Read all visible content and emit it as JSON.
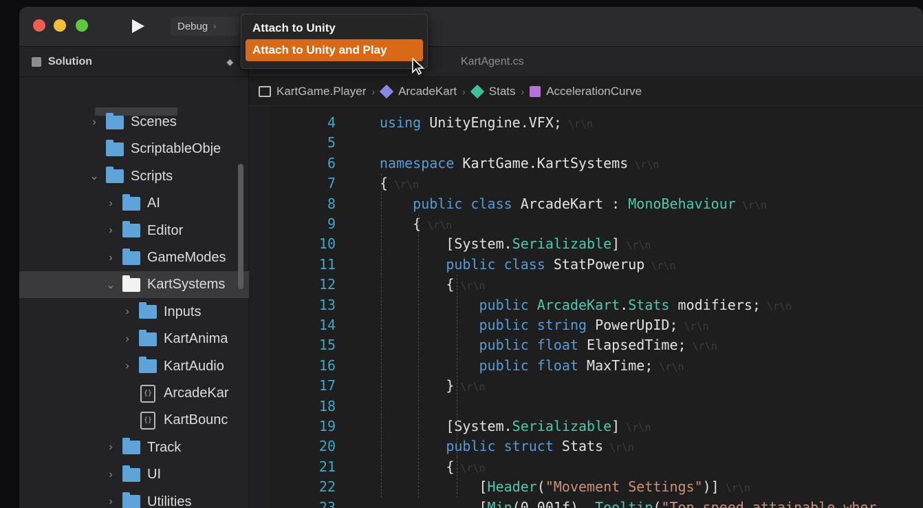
{
  "toolbar": {
    "configuration": "Debug",
    "run_menu": [
      {
        "label": "Attach to Unity",
        "active": false
      },
      {
        "label": "Attach to Unity and Play",
        "active": true
      }
    ]
  },
  "solution_pad": {
    "title": "Solution",
    "items": [
      {
        "label": "Scenes",
        "icon": "folder-icon",
        "expanded": false
      },
      {
        "label": "ScriptableObje",
        "icon": "folder-icon",
        "expanded": null
      },
      {
        "label": "Scripts",
        "icon": "folder-icon",
        "expanded": true
      },
      {
        "label": "AI",
        "icon": "folder-icon",
        "expanded": false
      },
      {
        "label": "Editor",
        "icon": "folder-icon",
        "expanded": false
      },
      {
        "label": "GameModes",
        "icon": "folder-icon",
        "expanded": false
      },
      {
        "label": "KartSystems",
        "icon": "folder-icon",
        "expanded": true,
        "selected": true
      },
      {
        "label": "Inputs",
        "icon": "folder-icon",
        "expanded": false
      },
      {
        "label": "KartAnima",
        "icon": "folder-icon",
        "expanded": false
      },
      {
        "label": "KartAudio",
        "icon": "folder-icon",
        "expanded": false
      },
      {
        "label": "ArcadeKar",
        "icon": "csharp-file-icon",
        "expanded": null
      },
      {
        "label": "KartBounc",
        "icon": "csharp-file-icon",
        "expanded": null
      },
      {
        "label": "Track",
        "icon": "folder-icon",
        "expanded": false
      },
      {
        "label": "UI",
        "icon": "folder-icon",
        "expanded": false
      },
      {
        "label": "Utilities",
        "icon": "folder-icon",
        "expanded": false
      }
    ]
  },
  "tabs": [
    {
      "label": "KartAgent.cs"
    }
  ],
  "breadcrumb": [
    {
      "label": "KartGame.Player",
      "icon": "class-icon"
    },
    {
      "label": "ArcadeKart",
      "icon": "class-diamond-icon"
    },
    {
      "label": "Stats",
      "icon": "struct-icon"
    },
    {
      "label": "AccelerationCurve",
      "icon": "property-icon"
    }
  ],
  "editor": {
    "lines": [
      {
        "n": "4",
        "code": "using UnityEngine.VFX;"
      },
      {
        "n": "5",
        "code": ""
      },
      {
        "n": "6",
        "code": "namespace KartGame.KartSystems"
      },
      {
        "n": "7",
        "code": "{"
      },
      {
        "n": "8",
        "code": "    public class ArcadeKart : MonoBehaviour"
      },
      {
        "n": "9",
        "code": "    {"
      },
      {
        "n": "10",
        "code": "        [System.Serializable]"
      },
      {
        "n": "11",
        "code": "        public class StatPowerup"
      },
      {
        "n": "12",
        "code": "        {"
      },
      {
        "n": "13",
        "code": "            public ArcadeKart.Stats modifiers;"
      },
      {
        "n": "14",
        "code": "            public string PowerUpID;"
      },
      {
        "n": "15",
        "code": "            public float ElapsedTime;"
      },
      {
        "n": "16",
        "code": "            public float MaxTime;"
      },
      {
        "n": "17",
        "code": "        }"
      },
      {
        "n": "18",
        "code": ""
      },
      {
        "n": "19",
        "code": "        [System.Serializable]"
      },
      {
        "n": "20",
        "code": "        public struct Stats"
      },
      {
        "n": "21",
        "code": "        {"
      },
      {
        "n": "22",
        "code": "            [Header(\"Movement Settings\")]"
      },
      {
        "n": "23",
        "code": "            [Min(0.001f), Tooltip(\"Top speed attainable wher"
      }
    ]
  },
  "colors": {
    "accent": "#d86a17",
    "keyword": "#569cd6",
    "type": "#4ec9b0",
    "string": "#ce9178",
    "line_number": "#3fa8c9",
    "folder": "#5ea4d8"
  }
}
